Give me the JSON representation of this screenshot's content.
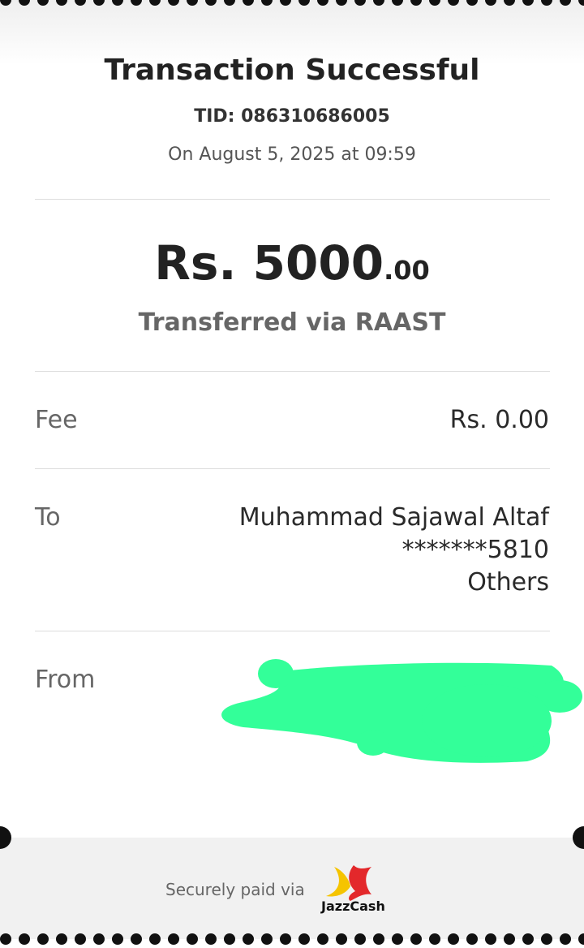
{
  "receipt": {
    "title": "Transaction Successful",
    "tid": "TID: 086310686005",
    "datetime": "On August 5, 2025 at 09:59",
    "amount_main": "Rs. 5000",
    "amount_cents": ".00",
    "transfer_method": "Transferred via RAAST"
  },
  "details": {
    "fee_label": "Fee",
    "fee_value": "Rs. 0.00",
    "to_label": "To",
    "to_name": "Muhammad Sajawal Altaf",
    "to_account": "*******5810",
    "to_bank": "Others",
    "from_label": "From"
  },
  "footer": {
    "secure_text": "Securely paid via",
    "brand": "JazzCash"
  },
  "colors": {
    "redaction": "#33ff99",
    "logo_yellow": "#f5c400",
    "logo_red": "#e3282b"
  },
  "icons": {
    "brand_logo": "jazzcash-logo-icon"
  }
}
